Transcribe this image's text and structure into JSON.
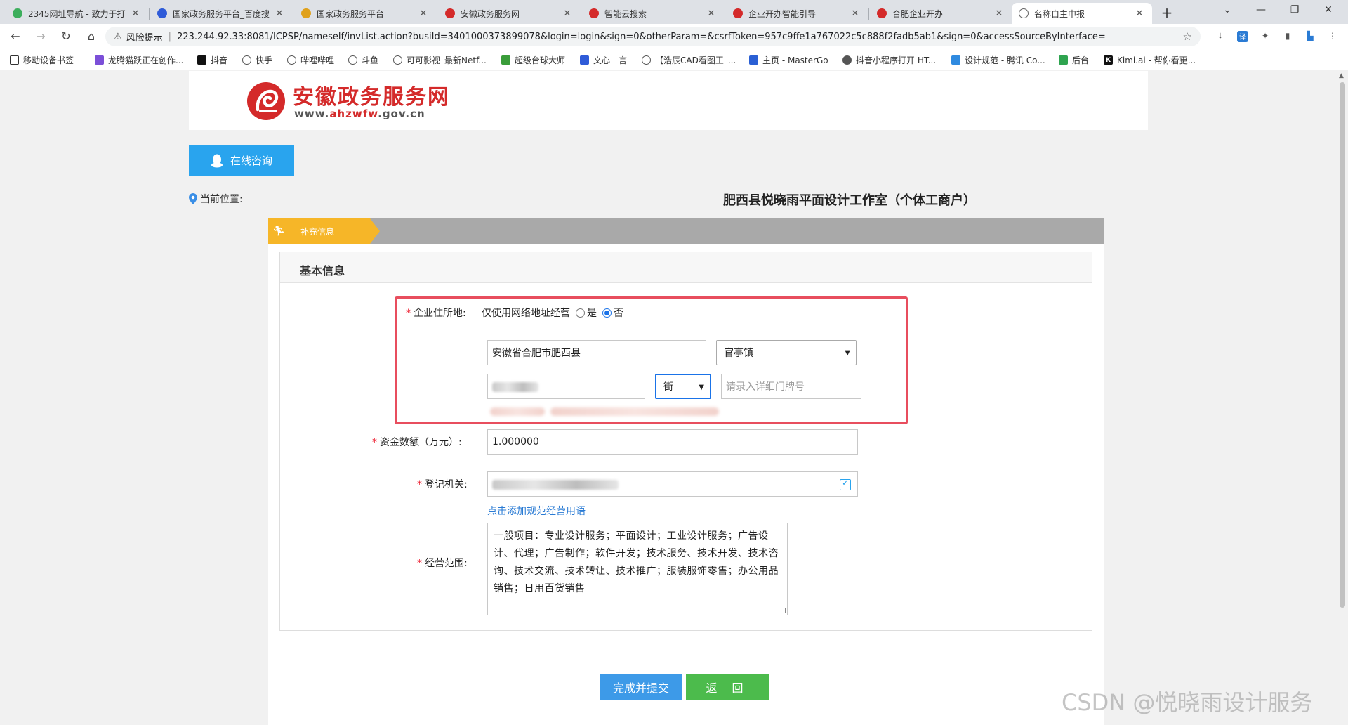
{
  "browser": {
    "tabs": [
      {
        "label": "2345网址导航 - 致力于打...",
        "icon_color": "#3cae5c"
      },
      {
        "label": "国家政务服务平台_百度搜...",
        "icon_color": "#2f5bd8"
      },
      {
        "label": "国家政务服务平台",
        "icon_color": "#e0a11b"
      },
      {
        "label": "安徽政务服务网",
        "icon_color": "#d42a2a"
      },
      {
        "label": "智能云搜索",
        "icon_color": "#d42a2a"
      },
      {
        "label": "企业开办智能引导",
        "icon_color": "#d42a2a"
      },
      {
        "label": "合肥企业开办",
        "icon_color": "#d42a2a"
      },
      {
        "label": "名称自主申报",
        "icon_color": "#666666"
      }
    ],
    "address": {
      "warning": "风险提示",
      "url": "223.244.92.33:8081/ICPSP/nameself/invList.action?busiId=3401000373899078&login=login&sign=0&otherParam=&csrfToken=957c9ffe1a767022c5c888f2fadb5ab1&sign=0&accessSourceByInterface="
    },
    "bookmarks": [
      {
        "label": "移动设备书签",
        "icon_color": "#333333"
      },
      {
        "label": "龙腾猫跃正在创作...",
        "icon_color": "#7b4fd8"
      },
      {
        "label": "抖音",
        "icon_color": "#111111"
      },
      {
        "label": "快手",
        "icon_color": "#666666"
      },
      {
        "label": "哔哩哔哩",
        "icon_color": "#666666"
      },
      {
        "label": "斗鱼",
        "icon_color": "#666666"
      },
      {
        "label": "可可影视_最新Netf...",
        "icon_color": "#666666"
      },
      {
        "label": "超级台球大师",
        "icon_color": "#3a9d3a"
      },
      {
        "label": "文心一言",
        "icon_color": "#2f5bd8"
      },
      {
        "label": "【浩辰CAD看图王_...",
        "icon_color": "#666666"
      },
      {
        "label": "主页 - MasterGo",
        "icon_color": "#2a5fd4"
      },
      {
        "label": "抖音小程序打开 HT...",
        "icon_color": "#555555"
      },
      {
        "label": "设计规范 - 腾讯 Co...",
        "icon_color": "#2f8ae0"
      },
      {
        "label": "后台",
        "icon_color": "#2ea44f"
      },
      {
        "label": "Kimi.ai - 帮你看更...",
        "icon_color": "#111111"
      }
    ]
  },
  "site": {
    "title": "安徽政务服务网",
    "url_prefix": "www.",
    "url_highlight": "ahzwfw",
    "url_suffix": ".gov.cn",
    "brand_color": "#d42a2a"
  },
  "consult_button": "在线咨询",
  "location_label": "当前位置:",
  "company_title": "肥西县悦晓雨平面设计工作室（个体工商户）",
  "step": {
    "active_label": "补充信息"
  },
  "form": {
    "section_title": "基本信息",
    "address": {
      "label": "企业住所地:",
      "online_only_label": "仅使用网络地址经营",
      "yes_label": "是",
      "no_label": "否",
      "selected": "否",
      "region_value": "安徽省合肥市肥西县",
      "town_value": "官亭镇",
      "street_type_value": "街",
      "detail_placeholder": "请录入详细门牌号"
    },
    "capital": {
      "label": "资金数额（万元）:",
      "value": "1.000000"
    },
    "authority": {
      "label": "登记机关:"
    },
    "scope": {
      "add_link": "点击添加规范经营用语",
      "label": "经营范围:",
      "value": "一般项目：专业设计服务；平面设计；工业设计服务；广告设计、代理；广告制作；软件开发；技术服务、技术开发、技术咨询、技术交流、技术转让、技术推广；服装服饰零售；办公用品销售；日用百货销售"
    },
    "submit_button": "完成并提交",
    "back_button": "返 回"
  },
  "watermark": "CSDN @悦晓雨设计服务"
}
